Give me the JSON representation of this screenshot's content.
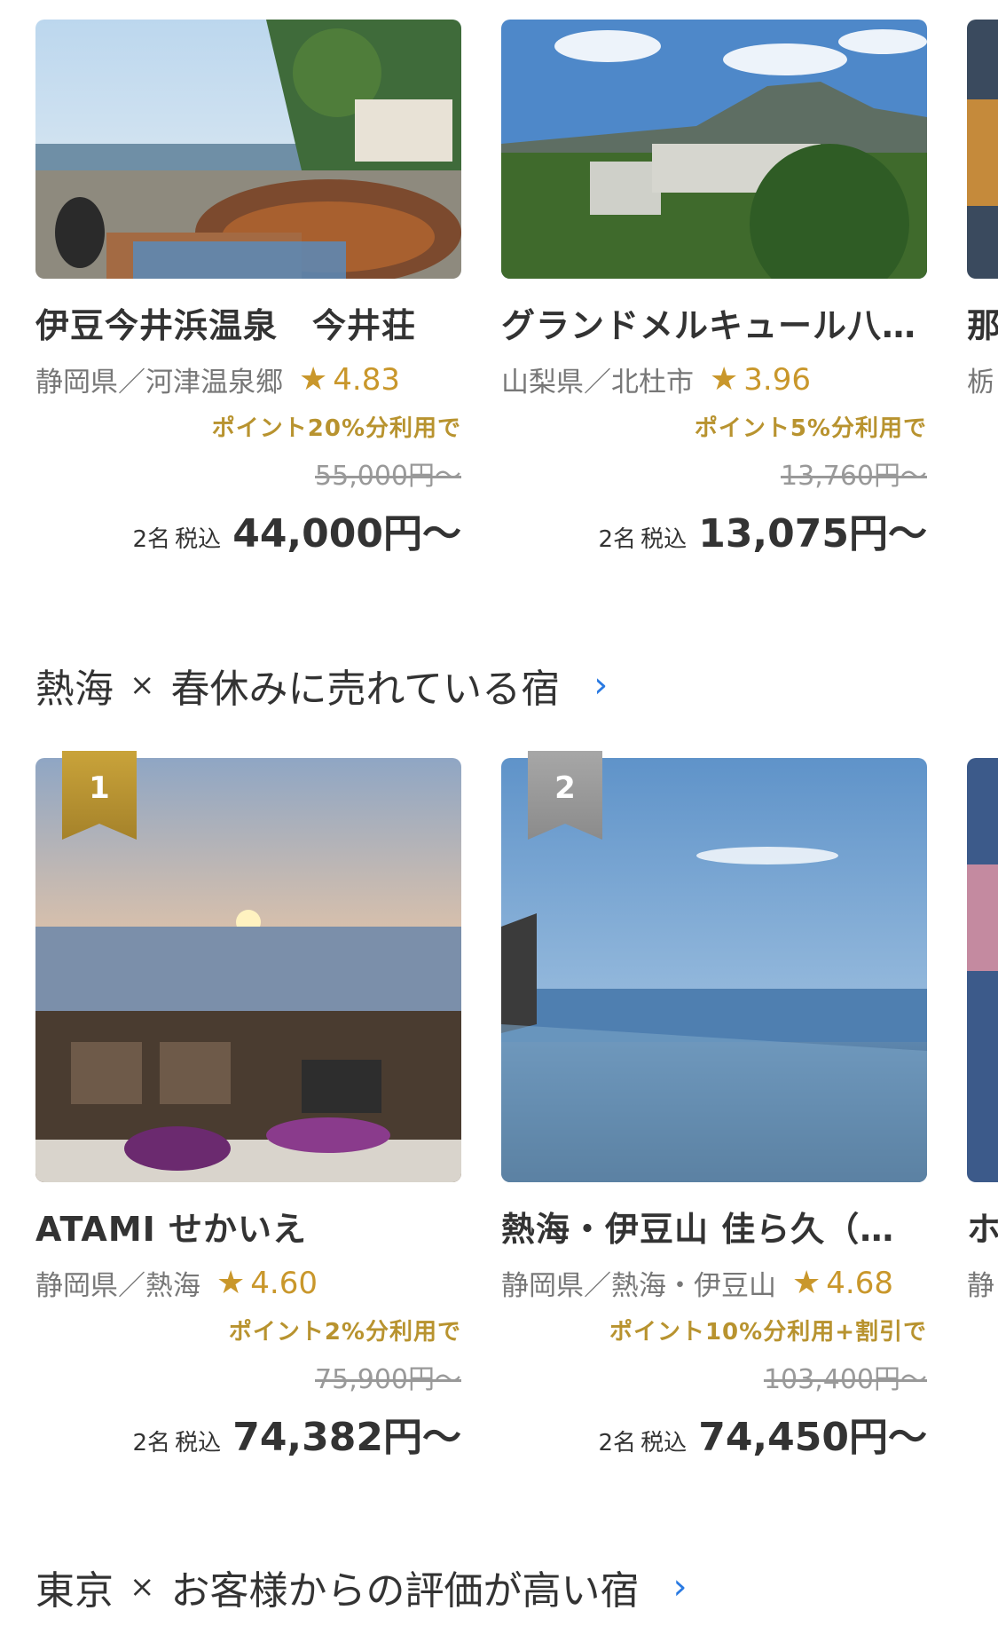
{
  "section1": {
    "cards": [
      {
        "name": "伊豆今井浜温泉　今井荘",
        "location": "静岡県／河津温泉郷",
        "rating": "4.83",
        "promo": "ポイント20%分利用で",
        "original_price": "55,000円〜",
        "guests": "2名",
        "tax": "税込",
        "price": "44,000円〜"
      },
      {
        "name": "グランドメルキュール八…",
        "location": "山梨県／北杜市",
        "rating": "3.96",
        "promo": "ポイント5%分利用で",
        "original_price": "13,760円〜",
        "guests": "2名",
        "tax": "税込",
        "price": "13,075円〜"
      },
      {
        "name": "那",
        "location": "栃"
      }
    ]
  },
  "section2": {
    "title_area": "熱海",
    "title_cross": "×",
    "title_text": "春休みに売れている宿",
    "cards": [
      {
        "rank": "1",
        "name": "ATAMI せかいえ",
        "location": "静岡県／熱海",
        "rating": "4.60",
        "promo": "ポイント2%分利用で",
        "original_price": "75,900円〜",
        "guests": "2名",
        "tax": "税込",
        "price": "74,382円〜"
      },
      {
        "rank": "2",
        "name": "熱海・伊豆山 佳ら久（…",
        "location": "静岡県／熱海・伊豆山",
        "rating": "4.68",
        "promo": "ポイント10%分利用+割引で",
        "original_price": "103,400円〜",
        "guests": "2名",
        "tax": "税込",
        "price": "74,450円〜"
      },
      {
        "name": "ホ",
        "location": "静"
      }
    ]
  },
  "section3": {
    "title_area": "東京",
    "title_cross": "×",
    "title_text": "お客様からの評価が高い宿"
  },
  "colors": {
    "accent_gold": "#c9972b",
    "promo_gold": "#b8932f",
    "link_blue": "#2a7ae2"
  },
  "icons": {
    "rating": "star-icon",
    "more": "chevron-right-icon",
    "rank": "ribbon-badge"
  }
}
